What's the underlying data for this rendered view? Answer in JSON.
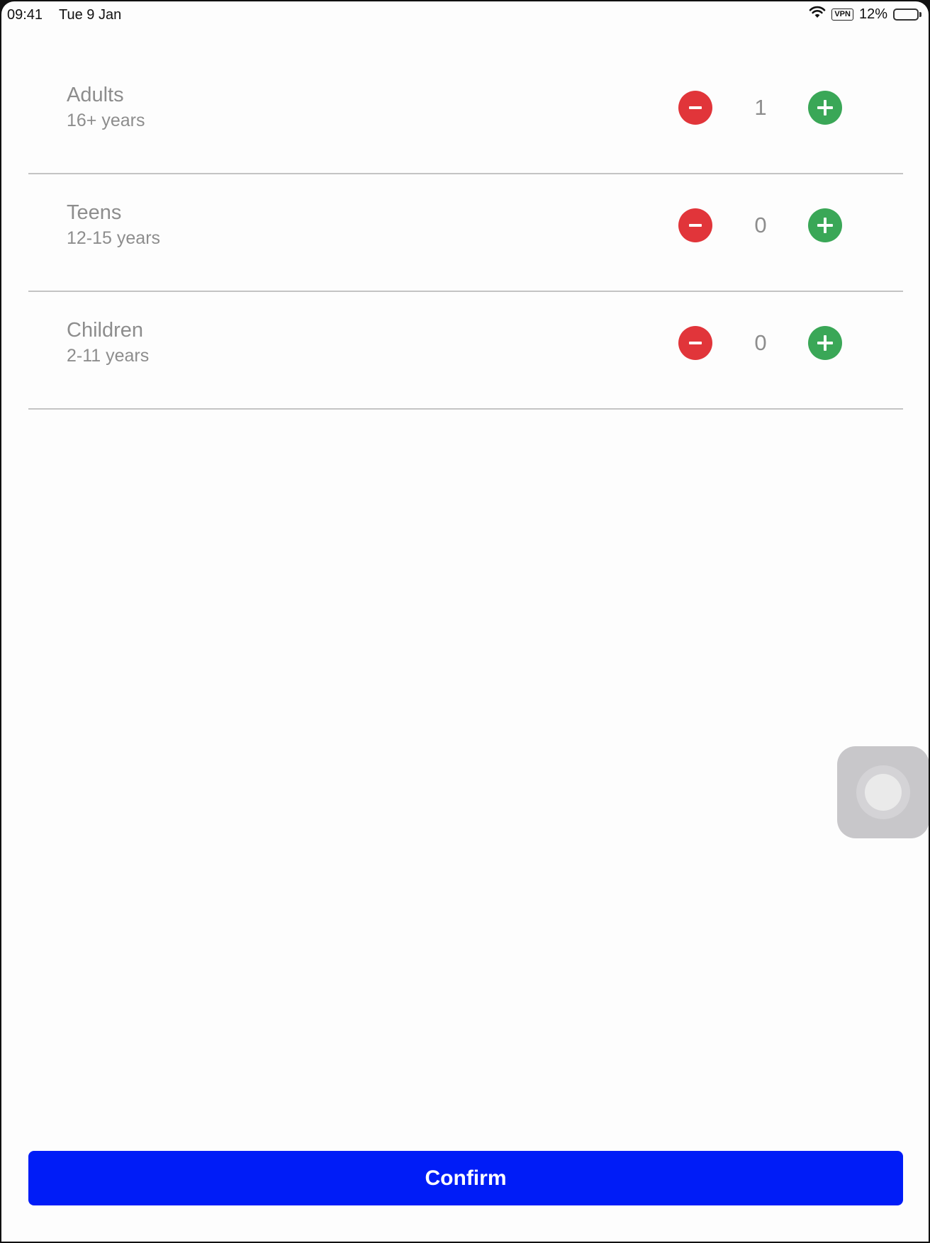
{
  "status_bar": {
    "time": "09:41",
    "date": "Tue 9 Jan",
    "vpn": "VPN",
    "battery": "12%",
    "icons": [
      "wifi-icon",
      "battery-charging-icon"
    ]
  },
  "passengers": [
    {
      "title": "Adults",
      "subtitle": "16+ years",
      "count": "1"
    },
    {
      "title": "Teens",
      "subtitle": "12-15 years",
      "count": "0"
    },
    {
      "title": "Children",
      "subtitle": "2-11 years",
      "count": "0"
    }
  ],
  "confirm": {
    "label": "Confirm"
  },
  "colors": {
    "minus": "#e1353a",
    "plus": "#3aa757",
    "confirm": "#001cf7",
    "label": "#8d8d8d"
  }
}
